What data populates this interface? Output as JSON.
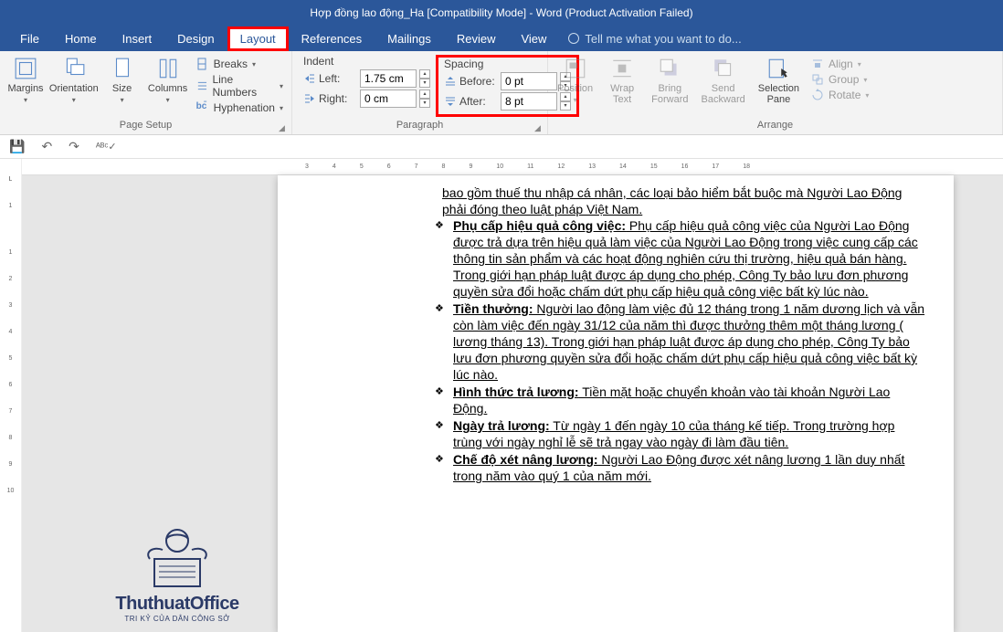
{
  "title": "Hợp đồng lao động_Ha  [Compatibility Mode] - Word (Product Activation Failed)",
  "menu": {
    "file": "File",
    "home": "Home",
    "insert": "Insert",
    "design": "Design",
    "layout": "Layout",
    "references": "References",
    "mailings": "Mailings",
    "review": "Review",
    "view": "View",
    "tellme": "Tell me what you want to do..."
  },
  "ribbon": {
    "page_setup": {
      "label": "Page Setup",
      "margins": "Margins",
      "orientation": "Orientation",
      "size": "Size",
      "columns": "Columns",
      "breaks": "Breaks",
      "line_numbers": "Line Numbers",
      "hyphenation": "Hyphenation"
    },
    "paragraph": {
      "label": "Paragraph",
      "indent": "Indent",
      "spacing": "Spacing",
      "left": "Left:",
      "right": "Right:",
      "before": "Before:",
      "after": "After:",
      "left_val": "1.75 cm",
      "right_val": "0 cm",
      "before_val": "0 pt",
      "after_val": "8 pt"
    },
    "arrange": {
      "label": "Arrange",
      "position": "Position",
      "wrap": "Wrap\nText",
      "bring": "Bring\nForward",
      "send": "Send\nBackward",
      "selection": "Selection\nPane",
      "align": "Align",
      "group": "Group",
      "rotate": "Rotate"
    }
  },
  "doc": {
    "frag_top": "bao gồm thuế thu nhập cá nhân, các loại bảo hiểm bắt buộc mà Người Lao Động phải đóng theo luật pháp Việt Nam.",
    "items": [
      {
        "head": "Phụ cấp hiệu quả công việc:",
        "body": " Phụ cấp hiệu quả công việc của Người Lao Động được trả dựa trên hiệu quả làm việc của Người Lao Động trong việc cung cấp các thông tin sản phẩm và các hoạt động nghiên cứu thị trường, hiệu quả bán hàng. Trong giới hạn pháp luật được áp dụng cho phép, Công Ty bảo lưu đơn phương quyền sửa đổi hoặc chấm dứt phụ cấp hiệu quả công việc bất kỳ lúc nào."
      },
      {
        "head": "Tiền thưởng:",
        "body": " Người lao động làm việc đủ 12 tháng trong 1 năm dương lịch và vẫn còn làm việc đến ngày 31/12 của năm thì được thưởng thêm một tháng lương ( lương tháng 13). Trong giới hạn pháp luật được áp dụng cho phép, Công Ty bảo lưu đơn phương quyền sửa đổi hoặc chấm dứt phụ cấp hiệu quả công việc bất kỳ lúc nào."
      },
      {
        "head": "Hình thức trả lương:",
        "body": " Tiền mặt hoặc chuyển khoản vào tài khoản Người Lao Động."
      },
      {
        "head": "Ngày trả lương:",
        "body": " Từ ngày 1 đến ngày 10 của tháng kế tiếp. Trong trường hợp trùng với ngày nghỉ lễ sẽ trả ngay vào ngày đi làm đầu tiên."
      },
      {
        "head": "Chế độ xét nâng lương:",
        "body": " Người Lao Động được xét nâng lương 1 lần duy nhất trong năm vào quý 1 của năm mới."
      }
    ]
  },
  "watermark": {
    "name": "ThuthuatOffice",
    "sub": "TRI KỶ CỦA DÂN CÔNG SỞ"
  },
  "ruler_h": [
    "3",
    "4",
    "5",
    "6",
    "7",
    "8",
    "9",
    "10",
    "11",
    "12",
    "13",
    "14",
    "15",
    "16",
    "17",
    "18"
  ],
  "ruler_v": [
    "1",
    "",
    "1",
    "2",
    "3",
    "4",
    "5",
    "6",
    "7",
    "8",
    "9",
    "10"
  ]
}
